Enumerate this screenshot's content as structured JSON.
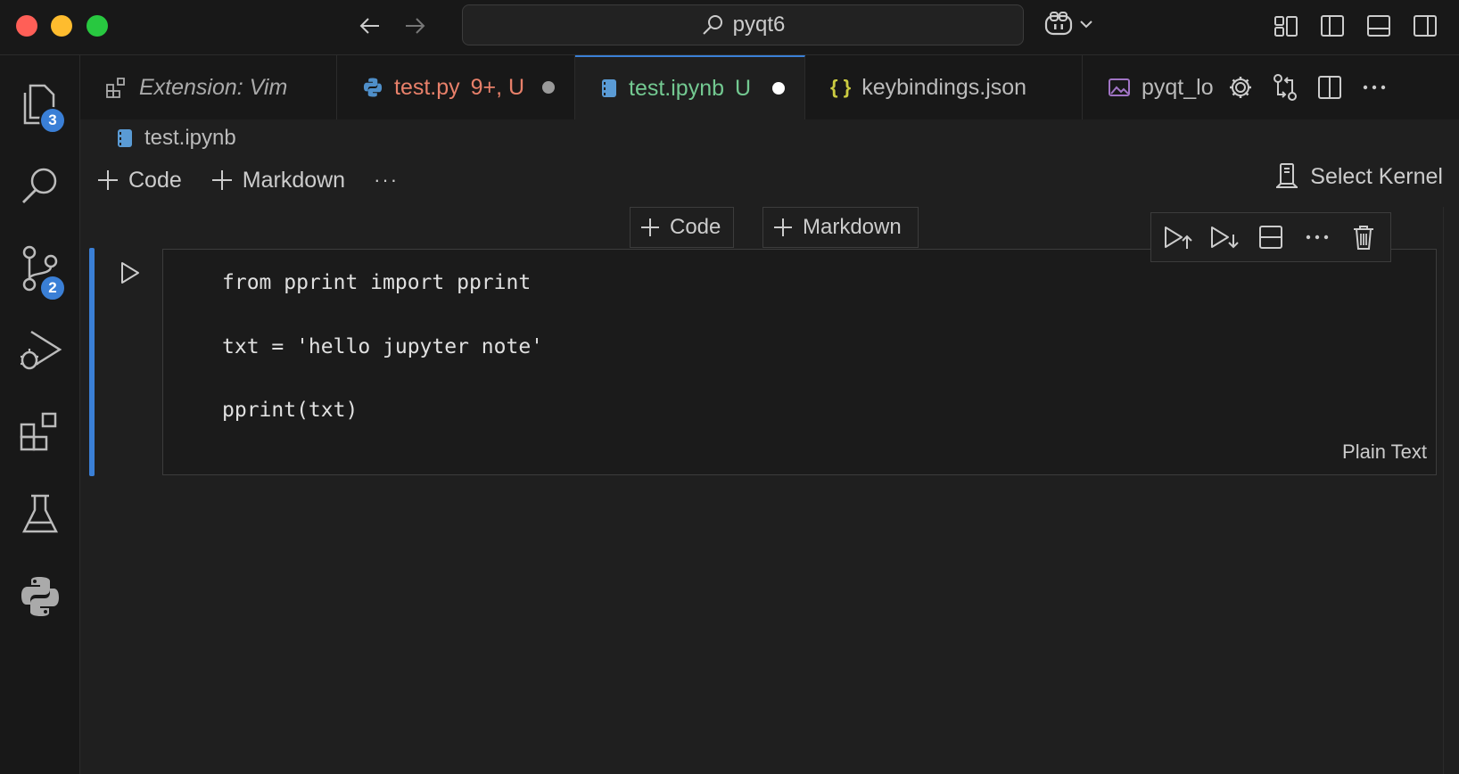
{
  "titlebar": {
    "command_center_text": "pyqt6",
    "icons": [
      "back-arrow-icon",
      "forward-arrow-icon",
      "search-icon",
      "copilot-icon",
      "chevron-down-icon",
      "customize-layout-icon",
      "toggle-primary-sidebar-icon",
      "toggle-panel-icon",
      "toggle-secondary-sidebar-icon"
    ]
  },
  "activitybar": {
    "items": [
      {
        "name": "explorer",
        "icon": "files-icon",
        "badge": "3"
      },
      {
        "name": "search",
        "icon": "search-icon",
        "badge": ""
      },
      {
        "name": "source-control",
        "icon": "source-control-icon",
        "badge": "2"
      },
      {
        "name": "run-and-debug",
        "icon": "run-debug-icon",
        "badge": ""
      },
      {
        "name": "extensions",
        "icon": "extensions-icon",
        "badge": ""
      },
      {
        "name": "testing",
        "icon": "beaker-icon",
        "badge": ""
      },
      {
        "name": "python",
        "icon": "python-icon",
        "badge": ""
      }
    ]
  },
  "tabs": [
    {
      "label": "Extension: Vim",
      "status": "",
      "modified": false,
      "active": false,
      "icon": "extension-icon",
      "color": "#aaaaaa"
    },
    {
      "label": "test.py",
      "status": "9+, U",
      "modified": true,
      "active": false,
      "icon": "python-file-icon",
      "color": "#e8806a"
    },
    {
      "label": "test.ipynb",
      "status": "U",
      "modified": true,
      "active": true,
      "icon": "notebook-icon",
      "color": "#73c991"
    },
    {
      "label": "keybindings.json",
      "status": "",
      "modified": false,
      "active": false,
      "icon": "json-icon",
      "color": "#bbbbbb"
    },
    {
      "label": "pyqt_lo",
      "status": "",
      "modified": false,
      "active": false,
      "icon": "image-file-icon",
      "color": "#bbbbbb"
    }
  ],
  "breadcrumb": {
    "file": "test.ipynb"
  },
  "notebook_toolbar": {
    "add_code": "Code",
    "add_markdown": "Markdown",
    "more": "···",
    "select_kernel": "Select Kernel"
  },
  "insert": {
    "code": "Code",
    "markdown": "Markdown"
  },
  "cell": {
    "lines": [
      "from pprint import pprint",
      "txt = 'hello jupyter note'",
      "pprint(txt)"
    ],
    "language": "Plain Text"
  },
  "cell_toolbar": [
    "execute-above-icon",
    "execute-below-icon",
    "split-cell-icon",
    "more-icon",
    "delete-icon"
  ],
  "colors": {
    "accent": "#3a7fd6",
    "background": "#1f1f1f",
    "sidebar": "#181818"
  }
}
